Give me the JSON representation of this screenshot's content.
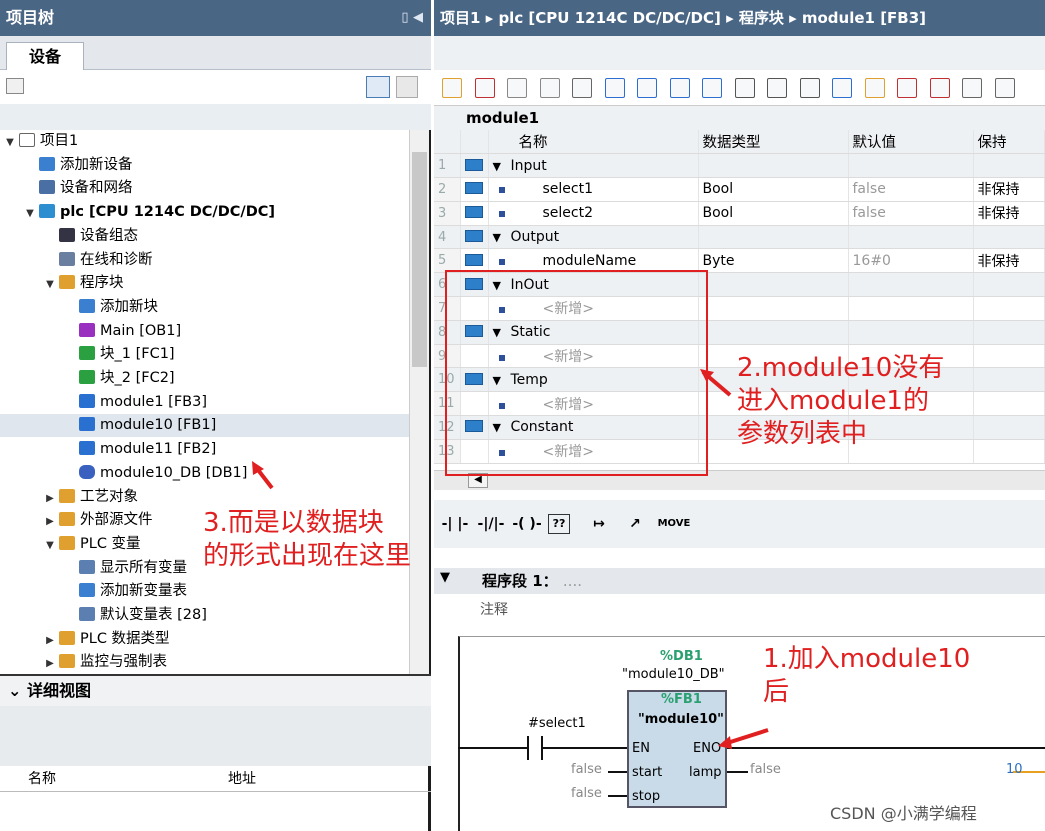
{
  "left_panel": {
    "title": "项目树",
    "tab": "设备",
    "tree": [
      {
        "label": "项目1",
        "indent": 0,
        "icon": "project-icon",
        "toggle": "▼"
      },
      {
        "label": "添加新设备",
        "indent": 1,
        "icon": "add-device-icon",
        "toggle": ""
      },
      {
        "label": "设备和网络",
        "indent": 1,
        "icon": "network-icon",
        "toggle": ""
      },
      {
        "label": "plc [CPU 1214C DC/DC/DC]",
        "indent": 1,
        "icon": "plc-icon",
        "toggle": "▼",
        "bold": true
      },
      {
        "label": "设备组态",
        "indent": 2,
        "icon": "device-config-icon",
        "toggle": ""
      },
      {
        "label": "在线和诊断",
        "indent": 2,
        "icon": "online-diagnostics-icon",
        "toggle": ""
      },
      {
        "label": "程序块",
        "indent": 2,
        "icon": "program-blocks-icon",
        "toggle": "▼"
      },
      {
        "label": "添加新块",
        "indent": 3,
        "icon": "add-block-icon",
        "toggle": ""
      },
      {
        "label": "Main [OB1]",
        "indent": 3,
        "icon": "ob-block-icon",
        "toggle": ""
      },
      {
        "label": "块_1 [FC1]",
        "indent": 3,
        "icon": "fc-block-icon",
        "toggle": ""
      },
      {
        "label": "块_2 [FC2]",
        "indent": 3,
        "icon": "fc-block-icon",
        "toggle": ""
      },
      {
        "label": "module1 [FB3]",
        "indent": 3,
        "icon": "fb-block-icon",
        "toggle": ""
      },
      {
        "label": "module10 [FB1]",
        "indent": 3,
        "icon": "fb-block-icon",
        "toggle": "",
        "selected": true
      },
      {
        "label": "module11 [FB2]",
        "indent": 3,
        "icon": "fb-block-icon",
        "toggle": ""
      },
      {
        "label": "module10_DB [DB1]",
        "indent": 3,
        "icon": "db-block-icon",
        "toggle": ""
      },
      {
        "label": "工艺对象",
        "indent": 2,
        "icon": "technology-objects-icon",
        "toggle": "▶"
      },
      {
        "label": "外部源文件",
        "indent": 2,
        "icon": "external-source-icon",
        "toggle": "▶"
      },
      {
        "label": "PLC 变量",
        "indent": 2,
        "icon": "plc-tags-icon",
        "toggle": "▼"
      },
      {
        "label": "显示所有变量",
        "indent": 3,
        "icon": "show-tags-icon",
        "toggle": ""
      },
      {
        "label": "添加新变量表",
        "indent": 3,
        "icon": "add-tag-table-icon",
        "toggle": ""
      },
      {
        "label": "默认变量表 [28]",
        "indent": 3,
        "icon": "tag-table-icon",
        "toggle": ""
      },
      {
        "label": "PLC 数据类型",
        "indent": 2,
        "icon": "plc-datatype-icon",
        "toggle": "▶"
      },
      {
        "label": "监控与强制表",
        "indent": 2,
        "icon": "watch-table-icon",
        "toggle": "▶"
      }
    ],
    "detail_title": "详细视图",
    "detail_columns": [
      "名称",
      "地址"
    ]
  },
  "right_panel": {
    "breadcrumb": [
      "项目1",
      "plc [CPU 1214C DC/DC/DC]",
      "程序块",
      "module1 [FB3]"
    ],
    "block_title": "module1",
    "columns": [
      "名称",
      "数据类型",
      "默认值",
      "保持"
    ],
    "rows": [
      {
        "num": "1",
        "section": true,
        "name": "Input",
        "type": "",
        "default": "",
        "retain": ""
      },
      {
        "num": "2",
        "section": false,
        "name": "select1",
        "type": "Bool",
        "default": "false",
        "retain": "非保持"
      },
      {
        "num": "3",
        "section": false,
        "name": "select2",
        "type": "Bool",
        "default": "false",
        "retain": "非保持"
      },
      {
        "num": "4",
        "section": true,
        "name": "Output",
        "type": "",
        "default": "",
        "retain": ""
      },
      {
        "num": "5",
        "section": false,
        "name": "moduleName",
        "type": "Byte",
        "default": "16#0",
        "retain": "非保持"
      },
      {
        "num": "6",
        "section": true,
        "name": "InOut",
        "type": "",
        "default": "",
        "retain": ""
      },
      {
        "num": "7",
        "section": false,
        "name": "<新增>",
        "type": "",
        "default": "",
        "retain": "",
        "placeholder": true
      },
      {
        "num": "8",
        "section": true,
        "name": "Static",
        "type": "",
        "default": "",
        "retain": ""
      },
      {
        "num": "9",
        "section": false,
        "name": "<新增>",
        "type": "",
        "default": "",
        "retain": "",
        "placeholder": true
      },
      {
        "num": "10",
        "section": true,
        "name": "Temp",
        "type": "",
        "default": "",
        "retain": ""
      },
      {
        "num": "11",
        "section": false,
        "name": "<新增>",
        "type": "",
        "default": "",
        "retain": "",
        "placeholder": true
      },
      {
        "num": "12",
        "section": true,
        "name": "Constant",
        "type": "",
        "default": "",
        "retain": ""
      },
      {
        "num": "13",
        "section": false,
        "name": "<新增>",
        "type": "",
        "default": "",
        "retain": "",
        "placeholder": true
      }
    ],
    "ladder_items": [
      "-| |-",
      "-|/|-",
      "-( )-",
      "??",
      "↦",
      "↗",
      "MOVE"
    ],
    "segment": {
      "title": "程序段 1：",
      "dots": "....",
      "comment": "注释"
    },
    "fb_call": {
      "db_addr": "%DB1",
      "db_name": "\"module10_DB\"",
      "fb_addr": "%FB1",
      "fb_name": "\"module10\"",
      "contact_label": "#select1",
      "pins_left": [
        "EN",
        "start",
        "stop"
      ],
      "pins_right": [
        "ENO",
        "lamp"
      ],
      "start_val": "false",
      "stop_val": "false",
      "lamp_val": "false",
      "right_val": "10"
    }
  },
  "annotations": {
    "a1_line1": "1.加入module10",
    "a1_line2": "后",
    "a2_line1": "2.module10没有",
    "a2_line2": "进入module1的",
    "a2_line3": "参数列表中",
    "a3_line1": "3.而是以数据块",
    "a3_line2": "的形式出现在这里",
    "color": "#e02020"
  },
  "watermark": "CSDN @小满学编程"
}
